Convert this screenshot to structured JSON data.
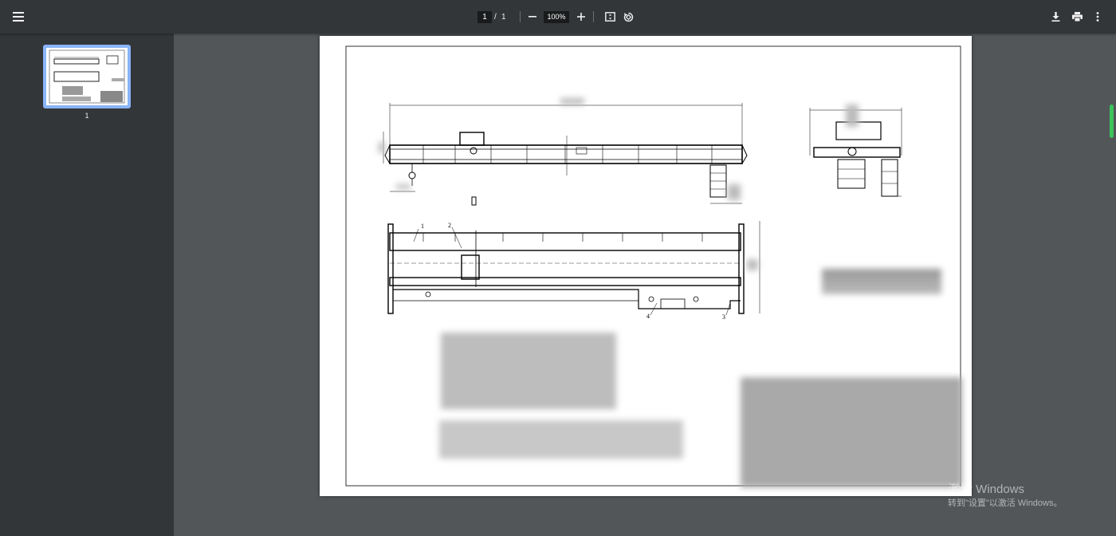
{
  "toolbar": {
    "page_current": "1",
    "page_separator": "/",
    "page_total": "1",
    "zoom_level": "100%",
    "icons": [
      "menu-icon",
      "minus-icon",
      "plus-icon",
      "fit-page-icon",
      "rotate-icon",
      "download-icon",
      "print-icon",
      "more-vert-icon"
    ]
  },
  "sidebar": {
    "thumbnails": [
      {
        "label": "1"
      }
    ]
  },
  "drawing": {
    "balloon_1": "1",
    "balloon_2": "2",
    "balloon_3": "3",
    "balloon_4": "4"
  },
  "watermark": {
    "title": "激活 Windows",
    "subtitle": "转到\"设置\"以激活 Windows。"
  },
  "colors": {
    "toolbar_bg": "#323639",
    "viewer_bg": "#525659",
    "thumb_selected": "#8ab4f8",
    "scroll_thumb": "#3cc35a"
  }
}
